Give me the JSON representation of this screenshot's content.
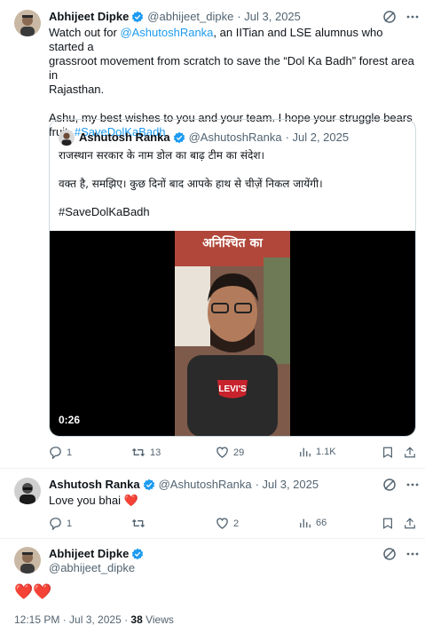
{
  "tweet": {
    "author_name": "Abhijeet Dipke",
    "author_handle": "@abhijeet_dipke",
    "date": "· Jul 3, 2025",
    "line1_pre": "Watch out for ",
    "line1_mention": "@AshutoshRanka",
    "line1_post": ", an IITian and LSE alumnus who started a",
    "line2": "grassroot movement from scratch to save the “Dol Ka Badh” forest area in",
    "line3": "Rajasthan.",
    "line4": "Ashu, my best wishes to you and your team. I hope your struggle bears",
    "line5_pre": "fruit. ",
    "line5_hashtag": "#SaveDolKaBadh"
  },
  "quote": {
    "author_name": "Ashutosh Ranka",
    "author_handle": "@AshutoshRanka",
    "date": "· Jul 2, 2025",
    "line1": "राजस्थान सरकार के नाम डोल का बाढ़ टीम का संदेश।",
    "line2": "वक्त है, समझिए। कुछ दिनों बाद आपके हाथ से चीज़ें निकल जायेंगी।",
    "line3": "#SaveDolKaBadh",
    "video_time": "0:26",
    "video_banner": "अनिश्चित का"
  },
  "tweet_actions": {
    "replies": "1",
    "reposts": "13",
    "likes": "29",
    "views": "1.1K"
  },
  "reply1": {
    "author_name": "Ashutosh Ranka",
    "author_handle": "@AshutoshRanka",
    "date": "· Jul 3, 2025",
    "text": "Love you bhai",
    "emoji": "❤️",
    "replies": "1",
    "likes": "2",
    "views": "66"
  },
  "reply2": {
    "author_name": "Abhijeet Dipke",
    "author_handle": "@abhijeet_dipke",
    "text": "❤️❤️",
    "time": "12:15 PM · Jul 3, 2025 · ",
    "views_count": "38",
    "views_label": " Views"
  },
  "colors": {
    "accent": "#1d9bf0",
    "muted": "#536471",
    "heart_red": "#f91880"
  },
  "icons": [
    "verified-badge-icon",
    "grok-icon",
    "more-icon",
    "reply-icon",
    "repost-icon",
    "like-icon",
    "views-icon",
    "bookmark-icon",
    "share-icon"
  ]
}
